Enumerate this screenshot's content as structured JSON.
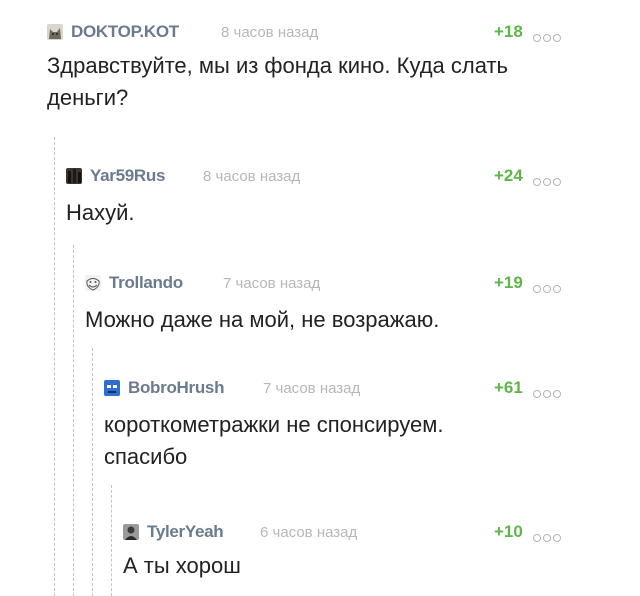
{
  "colors": {
    "username": "#6b7b8e",
    "timestamp": "#b7b7b7",
    "rating": "#5fb548",
    "text": "#222222",
    "thread_line": "#c4c4c4"
  },
  "comments": [
    {
      "username": "DOKTOP.KOT",
      "time": "8 часов назад",
      "rating": "+18",
      "text": "Здравствуйте, мы из фонда кино. Куда слать деньги?",
      "avatar_icon": "cat-avatar-icon"
    },
    {
      "username": "Yar59Rus",
      "time": "8 часов назад",
      "rating": "+24",
      "text": "Нахуй.",
      "avatar_icon": "dark-figures-avatar-icon"
    },
    {
      "username": "Trollando",
      "time": "7 часов назад",
      "rating": "+19",
      "text": "Можно даже на мой, не возражаю.",
      "avatar_icon": "trollface-avatar-icon"
    },
    {
      "username": "BobroHrush",
      "time": "7 часов назад",
      "rating": "+61",
      "text": "короткометражки не спонсируем. спасибо",
      "avatar_icon": "blue-face-avatar-icon"
    },
    {
      "username": "TylerYeah",
      "time": "6 часов назад",
      "rating": "+10",
      "text": "А ты хорош",
      "avatar_icon": "person-avatar-icon"
    }
  ]
}
